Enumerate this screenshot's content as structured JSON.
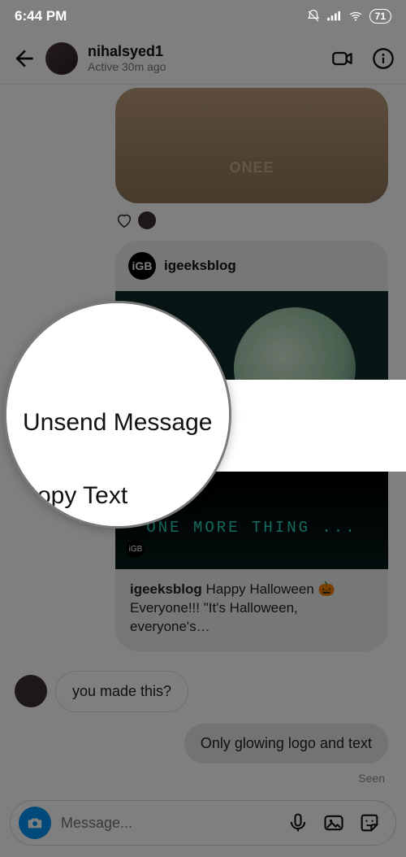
{
  "statusbar": {
    "time": "6:44 PM",
    "battery": "71"
  },
  "header": {
    "username": "nihalsyed1",
    "active": "Active 30m ago"
  },
  "gif": {
    "tshirt": "ONEE"
  },
  "post": {
    "username": "igeeksblog",
    "avatar_text": "iGB",
    "overlay_text": "ONE MORE THING ...",
    "caption_user": "igeeksblog",
    "caption_text": " Happy Halloween 🎃 Everyone!!! \"It's Halloween, everyone's…"
  },
  "messages": {
    "incoming": "you made this?",
    "outgoing": "Only glowing logo and text",
    "seen": "Seen"
  },
  "composer": {
    "placeholder": "Message..."
  },
  "context_menu": {
    "unsend": "Unsend Message",
    "copy": "opy Text"
  }
}
